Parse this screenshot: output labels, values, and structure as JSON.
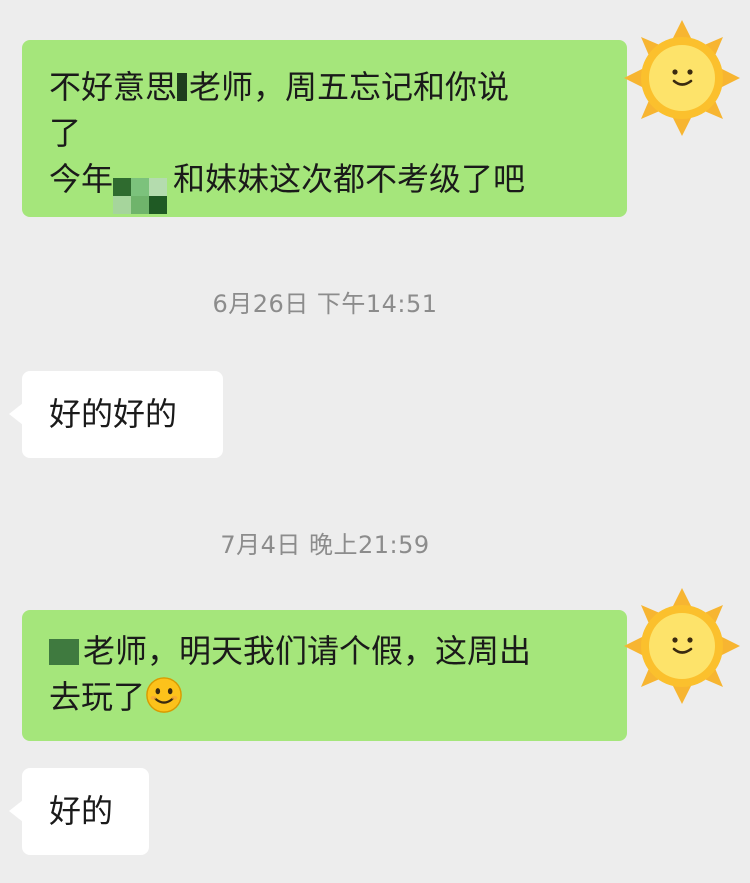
{
  "messages": [
    {
      "sender": "me",
      "lines": [
        "不好意思",
        "老师，周五忘记和你说",
        "了",
        "今年",
        "和妹妹这次都不考级了吧"
      ]
    },
    {
      "timestamp": "6月26日 下午14:51"
    },
    {
      "sender": "other",
      "text": "好的好的"
    },
    {
      "timestamp": "7月4日 晚上21:59"
    },
    {
      "sender": "me",
      "lines": [
        "老师，明天我们请个假，这周出",
        "去玩了"
      ]
    },
    {
      "sender": "other",
      "text": "好的"
    }
  ],
  "colors": {
    "background": "#ededed",
    "sent_bubble": "#a5e67b",
    "received_bubble": "#ffffff",
    "timestamp_text": "#8c8c8c"
  },
  "icons": {
    "self_avatar": "sun-avatar-icon",
    "emoji": "smiling-face-emoji-icon",
    "redaction": "mosaic-redaction-icon"
  }
}
